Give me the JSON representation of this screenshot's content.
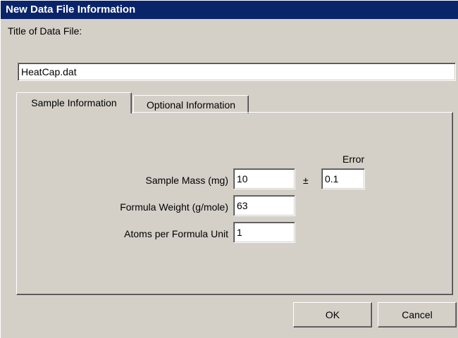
{
  "window": {
    "title": "New Data File Information"
  },
  "file": {
    "title_label": "Title of Data File:",
    "title_value": "HeatCap.dat"
  },
  "tabs": [
    {
      "label": "Sample Information",
      "active": true
    },
    {
      "label": "Optional Information",
      "active": false
    }
  ],
  "sample": {
    "error_header": "Error",
    "plus_minus": "±",
    "mass_label": "Sample Mass (mg)",
    "mass_value": "10",
    "mass_error_value": "0.1",
    "weight_label": "Formula Weight (g/mole)",
    "weight_value": "63",
    "atoms_label": "Atoms per Formula Unit",
    "atoms_value": "1"
  },
  "buttons": {
    "ok_label": "OK",
    "cancel_label": "Cancel"
  },
  "colors": {
    "titlebar": "#0a246a",
    "dialog_face": "#d4d0c8",
    "field_background": "#ffffff"
  }
}
